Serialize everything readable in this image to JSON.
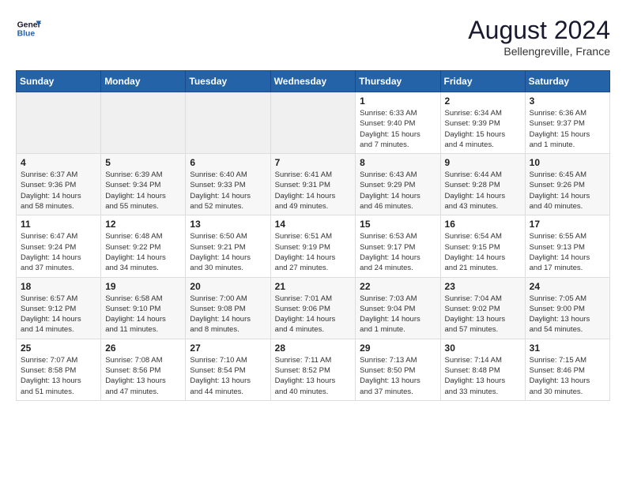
{
  "header": {
    "logo_line1": "General",
    "logo_line2": "Blue",
    "month_year": "August 2024",
    "location": "Bellengreville, France"
  },
  "weekdays": [
    "Sunday",
    "Monday",
    "Tuesday",
    "Wednesday",
    "Thursday",
    "Friday",
    "Saturday"
  ],
  "weeks": [
    [
      {
        "day": "",
        "info": ""
      },
      {
        "day": "",
        "info": ""
      },
      {
        "day": "",
        "info": ""
      },
      {
        "day": "",
        "info": ""
      },
      {
        "day": "1",
        "info": "Sunrise: 6:33 AM\nSunset: 9:40 PM\nDaylight: 15 hours\nand 7 minutes."
      },
      {
        "day": "2",
        "info": "Sunrise: 6:34 AM\nSunset: 9:39 PM\nDaylight: 15 hours\nand 4 minutes."
      },
      {
        "day": "3",
        "info": "Sunrise: 6:36 AM\nSunset: 9:37 PM\nDaylight: 15 hours\nand 1 minute."
      }
    ],
    [
      {
        "day": "4",
        "info": "Sunrise: 6:37 AM\nSunset: 9:36 PM\nDaylight: 14 hours\nand 58 minutes."
      },
      {
        "day": "5",
        "info": "Sunrise: 6:39 AM\nSunset: 9:34 PM\nDaylight: 14 hours\nand 55 minutes."
      },
      {
        "day": "6",
        "info": "Sunrise: 6:40 AM\nSunset: 9:33 PM\nDaylight: 14 hours\nand 52 minutes."
      },
      {
        "day": "7",
        "info": "Sunrise: 6:41 AM\nSunset: 9:31 PM\nDaylight: 14 hours\nand 49 minutes."
      },
      {
        "day": "8",
        "info": "Sunrise: 6:43 AM\nSunset: 9:29 PM\nDaylight: 14 hours\nand 46 minutes."
      },
      {
        "day": "9",
        "info": "Sunrise: 6:44 AM\nSunset: 9:28 PM\nDaylight: 14 hours\nand 43 minutes."
      },
      {
        "day": "10",
        "info": "Sunrise: 6:45 AM\nSunset: 9:26 PM\nDaylight: 14 hours\nand 40 minutes."
      }
    ],
    [
      {
        "day": "11",
        "info": "Sunrise: 6:47 AM\nSunset: 9:24 PM\nDaylight: 14 hours\nand 37 minutes."
      },
      {
        "day": "12",
        "info": "Sunrise: 6:48 AM\nSunset: 9:22 PM\nDaylight: 14 hours\nand 34 minutes."
      },
      {
        "day": "13",
        "info": "Sunrise: 6:50 AM\nSunset: 9:21 PM\nDaylight: 14 hours\nand 30 minutes."
      },
      {
        "day": "14",
        "info": "Sunrise: 6:51 AM\nSunset: 9:19 PM\nDaylight: 14 hours\nand 27 minutes."
      },
      {
        "day": "15",
        "info": "Sunrise: 6:53 AM\nSunset: 9:17 PM\nDaylight: 14 hours\nand 24 minutes."
      },
      {
        "day": "16",
        "info": "Sunrise: 6:54 AM\nSunset: 9:15 PM\nDaylight: 14 hours\nand 21 minutes."
      },
      {
        "day": "17",
        "info": "Sunrise: 6:55 AM\nSunset: 9:13 PM\nDaylight: 14 hours\nand 17 minutes."
      }
    ],
    [
      {
        "day": "18",
        "info": "Sunrise: 6:57 AM\nSunset: 9:12 PM\nDaylight: 14 hours\nand 14 minutes."
      },
      {
        "day": "19",
        "info": "Sunrise: 6:58 AM\nSunset: 9:10 PM\nDaylight: 14 hours\nand 11 minutes."
      },
      {
        "day": "20",
        "info": "Sunrise: 7:00 AM\nSunset: 9:08 PM\nDaylight: 14 hours\nand 8 minutes."
      },
      {
        "day": "21",
        "info": "Sunrise: 7:01 AM\nSunset: 9:06 PM\nDaylight: 14 hours\nand 4 minutes."
      },
      {
        "day": "22",
        "info": "Sunrise: 7:03 AM\nSunset: 9:04 PM\nDaylight: 14 hours\nand 1 minute."
      },
      {
        "day": "23",
        "info": "Sunrise: 7:04 AM\nSunset: 9:02 PM\nDaylight: 13 hours\nand 57 minutes."
      },
      {
        "day": "24",
        "info": "Sunrise: 7:05 AM\nSunset: 9:00 PM\nDaylight: 13 hours\nand 54 minutes."
      }
    ],
    [
      {
        "day": "25",
        "info": "Sunrise: 7:07 AM\nSunset: 8:58 PM\nDaylight: 13 hours\nand 51 minutes."
      },
      {
        "day": "26",
        "info": "Sunrise: 7:08 AM\nSunset: 8:56 PM\nDaylight: 13 hours\nand 47 minutes."
      },
      {
        "day": "27",
        "info": "Sunrise: 7:10 AM\nSunset: 8:54 PM\nDaylight: 13 hours\nand 44 minutes."
      },
      {
        "day": "28",
        "info": "Sunrise: 7:11 AM\nSunset: 8:52 PM\nDaylight: 13 hours\nand 40 minutes."
      },
      {
        "day": "29",
        "info": "Sunrise: 7:13 AM\nSunset: 8:50 PM\nDaylight: 13 hours\nand 37 minutes."
      },
      {
        "day": "30",
        "info": "Sunrise: 7:14 AM\nSunset: 8:48 PM\nDaylight: 13 hours\nand 33 minutes."
      },
      {
        "day": "31",
        "info": "Sunrise: 7:15 AM\nSunset: 8:46 PM\nDaylight: 13 hours\nand 30 minutes."
      }
    ]
  ]
}
